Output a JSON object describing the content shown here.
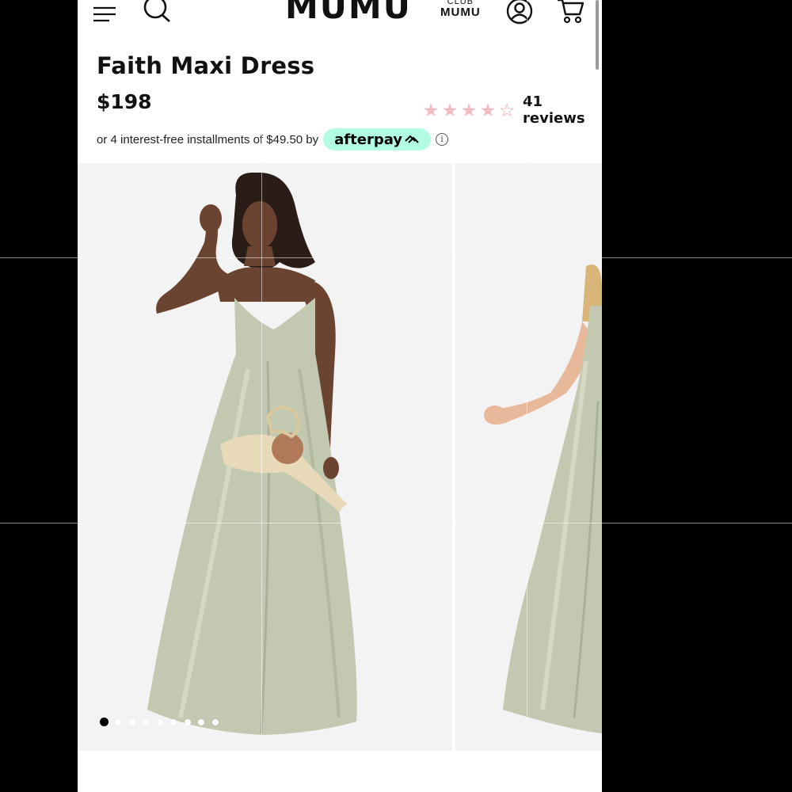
{
  "header": {
    "logo": "MUMU",
    "club_top": "CLUB",
    "club_bottom": "MUMU",
    "icons": [
      "menu-icon",
      "search-icon",
      "account-icon",
      "cart-icon"
    ]
  },
  "product": {
    "title": "Faith Maxi Dress",
    "price": "$198",
    "rating": 4,
    "rating_max": 5,
    "reviews_label": "41 reviews",
    "installments_text": "or 4 interest-free installments of $49.50 by",
    "afterpay_label": "afterpay",
    "info_symbol": "i"
  },
  "gallery": {
    "slide_count": 9,
    "active_index": 0
  },
  "colors": {
    "star": "#f1bcc0",
    "afterpay_bg": "#b2fce4",
    "dress": "#c2c9b0",
    "background": "#f3f3f3"
  }
}
